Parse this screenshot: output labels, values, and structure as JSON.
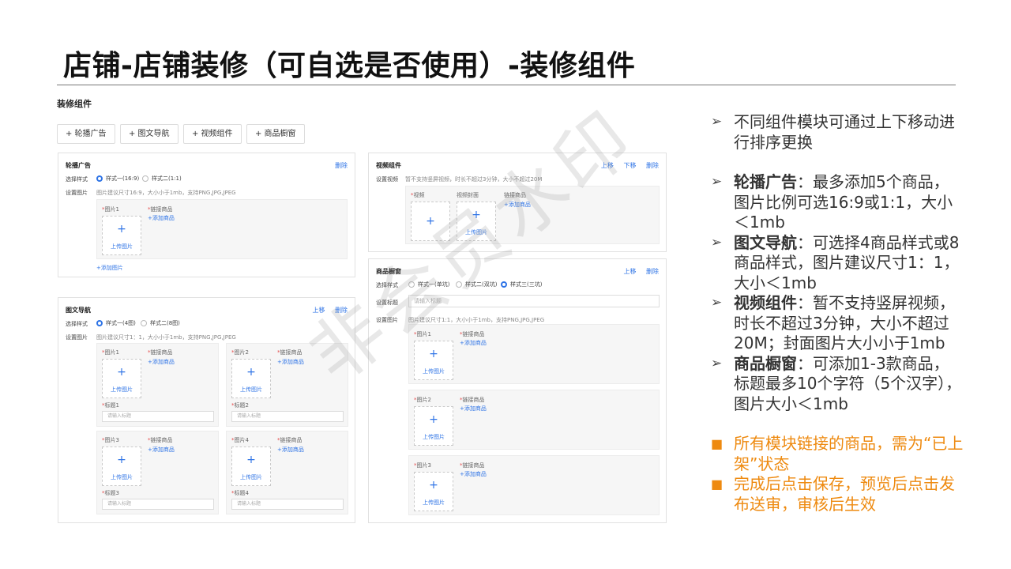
{
  "slide": {
    "title": "店铺-店铺装修（可自选是否使用）-装修组件",
    "watermark": "非会员水印"
  },
  "editor": {
    "heading": "装修组件",
    "toolbar": [
      "+ 轮播广告",
      "+ 图文导航",
      "+ 视频组件",
      "+ 商品橱窗"
    ],
    "carousel": {
      "title": "轮播广告",
      "delete": "删除",
      "style_label": "选择样式",
      "style_options": [
        "样式一(16:9)",
        "样式二(1:1)"
      ],
      "image_label": "设置图片",
      "image_hint": "图片建议尺寸16:9，大小小于1mb，支持PNG,JPG,JPEG",
      "image_slot_label": "图片1",
      "link_label": "链接商品",
      "add_goods": "+添加商品",
      "upload_text": "上传图片",
      "add_image": "+添加图片"
    },
    "nav": {
      "title": "图文导航",
      "up": "上移",
      "delete": "删除",
      "style_label": "选择样式",
      "style_options": [
        "样式一(4图)",
        "样式二(8图)"
      ],
      "image_label": "设置图片",
      "image_hint": "图片建议尺寸1：1，大小小于1mb，支持PNG,JPG,JPEG",
      "cards": [
        {
          "image": "图片1",
          "title_label": "标题1"
        },
        {
          "image": "图片2",
          "title_label": "标题2"
        },
        {
          "image": "图片3",
          "title_label": "标题3"
        },
        {
          "image": "图片4",
          "title_label": "标题4"
        }
      ],
      "link_label": "链接商品",
      "add_goods": "+添加商品",
      "upload_text": "上传图片",
      "title_placeholder": "请输入标题"
    },
    "video": {
      "title": "视频组件",
      "up": "上移",
      "down": "下移",
      "delete": "删除",
      "video_label": "设置视频",
      "video_hint": "暂不支持竖屏视频，时长不超过3分钟，大小不超过20M",
      "col_video": "视频",
      "col_cover": "视频封面",
      "col_link": "链接商品",
      "add_goods": "+添加商品",
      "upload_text": "上传图片"
    },
    "window": {
      "title": "商品橱窗",
      "up": "上移",
      "delete": "删除",
      "style_label": "选择样式",
      "style_options": [
        "样式一(单坑)",
        "样式二(双坑)",
        "样式三(三坑)"
      ],
      "title_label": "设置标题",
      "title_placeholder": "请输入标题",
      "image_label": "设置图片",
      "image_hint": "图片建议尺寸1:1，大小小于1mb，支持PNG,JPG,JPEG",
      "slots": [
        "图片1",
        "图片2",
        "图片3"
      ],
      "link_label": "链接商品",
      "add_goods": "+添加商品",
      "upload_text": "上传图片"
    }
  },
  "notes": {
    "n1": "不同组件模块可通过上下移动进行排序更换",
    "n2_key": "轮播广告",
    "n2": "：最多添加5个商品，图片比例可选16:9或1:1，大小＜1mb",
    "n3_key": "图文导航",
    "n3": "：可选择4商品样式或8商品样式，图片建议尺寸1：1，大小＜1mb",
    "n4_key": "视频组件",
    "n4": "：暂不支持竖屏视频，时长不超过3分钟，大小不超过20M；封面图片大小小于1mb",
    "n5_key": "商品橱窗",
    "n5": "：可添加1-3款商品，标题最多10个字符（5个汉字），图片大小＜1mb",
    "o1": "所有模块链接的商品，需为“已上架”状态",
    "o2": "完成后点击保存，预览后点击发布送审，审核后生效",
    "accent_color": "#ee8a10"
  }
}
